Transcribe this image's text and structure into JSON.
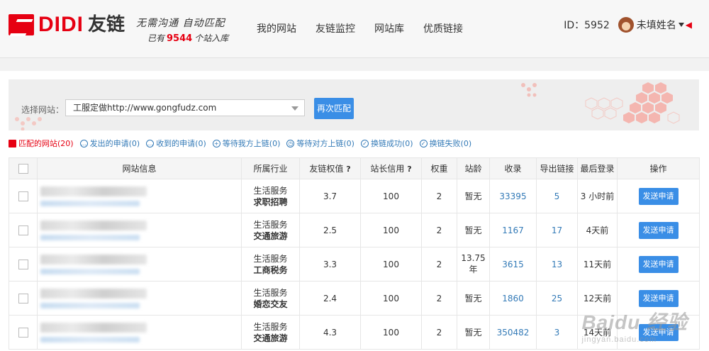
{
  "brand": {
    "logo_text": "DIDI",
    "logo_cn": "友链",
    "slogan_line1": "无需沟通  自动匹配",
    "slogan_prefix": "已有",
    "site_count": "9544",
    "slogan_suffix": "个站入库"
  },
  "nav": [
    "我的网站",
    "友链监控",
    "网站库",
    "优质链接"
  ],
  "user": {
    "id_label": "ID：5952",
    "name": "未填姓名"
  },
  "filter": {
    "label": "选择网站：",
    "selected_site": "工服定做http://www.gongfudz.com",
    "rematch_button": "再次匹配"
  },
  "tabs": [
    {
      "label": "匹配的网站(20)",
      "icon": "stack-icon",
      "active": true
    },
    {
      "label": "发出的申请(0)",
      "icon": "chat-icon"
    },
    {
      "label": "收到的申请(0)",
      "icon": "chat-filled-icon"
    },
    {
      "label": "等待我方上链(0)",
      "icon": "plus-circle-icon"
    },
    {
      "label": "等待对方上链(0)",
      "icon": "clock-icon"
    },
    {
      "label": "换链成功(0)",
      "icon": "check-circle-icon"
    },
    {
      "label": "换链失败(0)",
      "icon": "check-circle-icon"
    }
  ],
  "table": {
    "headers": {
      "site": "网站信息",
      "industry": "所属行业",
      "weight_value": "友链权值",
      "credit": "站长信用",
      "rank": "权重",
      "age": "站龄",
      "indexed": "收录",
      "outlinks": "导出链接",
      "last_login": "最后登录",
      "action": "操作"
    },
    "help_mark": "?",
    "rows": [
      {
        "industry": "生活服务",
        "sub": "求职招聘",
        "weight": "3.7",
        "credit": "100",
        "rank": "2",
        "age": "暂无",
        "indexed": "33395",
        "outlinks": "5",
        "last_login": "3 小时前",
        "action": "发送申请"
      },
      {
        "industry": "生活服务",
        "sub": "交通旅游",
        "weight": "2.5",
        "credit": "100",
        "rank": "2",
        "age": "暂无",
        "indexed": "1167",
        "outlinks": "17",
        "last_login": "4天前",
        "action": "发送申请"
      },
      {
        "industry": "生活服务",
        "sub": "工商税务",
        "weight": "3.3",
        "credit": "100",
        "rank": "2",
        "age": "13.75年",
        "indexed": "3615",
        "outlinks": "13",
        "last_login": "11天前",
        "action": "发送申请"
      },
      {
        "industry": "生活服务",
        "sub": "婚恋交友",
        "weight": "2.4",
        "credit": "100",
        "rank": "2",
        "age": "暂无",
        "indexed": "1860",
        "outlinks": "25",
        "last_login": "12天前",
        "action": "发送申请"
      },
      {
        "industry": "生活服务",
        "sub": "交通旅游",
        "weight": "4.3",
        "credit": "100",
        "rank": "2",
        "age": "暂无",
        "indexed": "350482",
        "outlinks": "3",
        "last_login": "14天前",
        "action": "发送申请"
      }
    ]
  },
  "watermark": {
    "big": "Baidu 经验",
    "small": "jingyan.baidu.com"
  },
  "colors": {
    "brand_red": "#e60012",
    "link_blue": "#337ab7",
    "button_blue": "#3a8ee6"
  }
}
